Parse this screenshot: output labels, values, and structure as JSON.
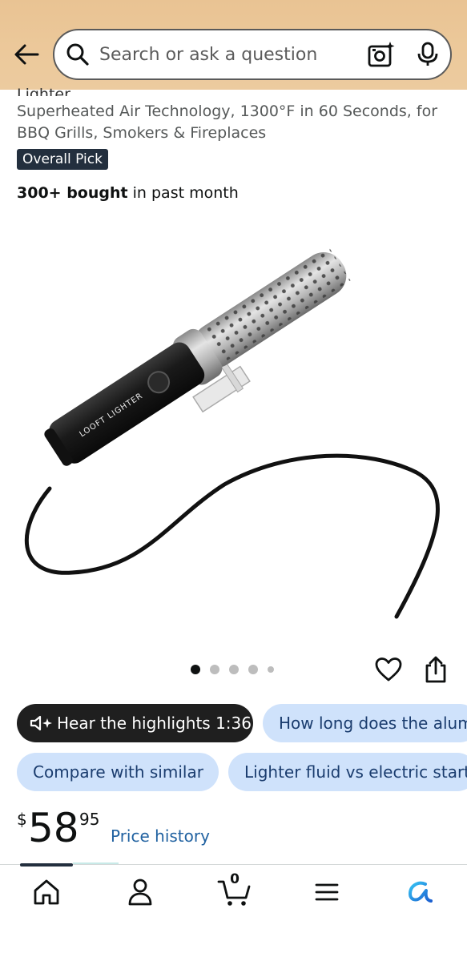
{
  "header": {
    "search_placeholder": "Search or ask a question"
  },
  "product": {
    "title_cut": "Lighter",
    "subtitle": "Superheated Air Technology, 1300°F in 60 Seconds, for BBQ Grills, Smokers & Fireplaces",
    "badge": "Overall Pick",
    "bought_bold": "300+ bought",
    "bought_rest": " in past month",
    "device_label": "LOOFT LIGHTER"
  },
  "carousel": {
    "total": 5,
    "active_index": 0
  },
  "chips": {
    "hear": "Hear the highlights 1:36",
    "question": "How long does the alum",
    "compare": "Compare with similar",
    "fluid": "Lighter fluid vs electric start"
  },
  "price": {
    "currency": "$",
    "whole": "58",
    "fraction": "95",
    "history_label": "Price history"
  },
  "bottom_nav": {
    "cart_count": "0"
  },
  "colors": {
    "header_bg": "#ecc99b",
    "badge_bg": "#232f3e",
    "chip_blue": "#cfe2fb",
    "link": "#2162a1",
    "rufus": "#1b7bd6"
  }
}
